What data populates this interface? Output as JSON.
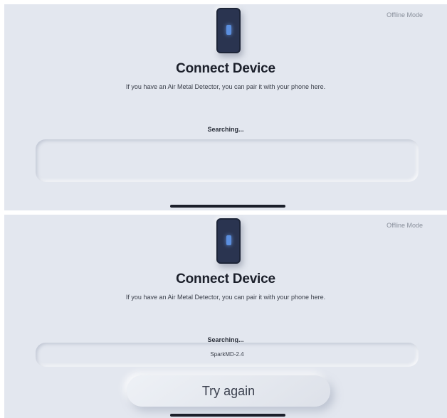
{
  "screens": [
    {
      "offline_mode": "Offline Mode",
      "title": "Connect Device",
      "subtitle": "If you have an Air Metal Detector, you can pair it with your phone here.",
      "status": "Searching...",
      "device_name": ""
    },
    {
      "offline_mode": "Offline Mode",
      "title": "Connect Device",
      "subtitle": "If you have an Air Metal Detector, you can pair it with your phone here.",
      "status": "Searching...",
      "device_name": "SparkMD-2.4",
      "try_again_label": "Try again"
    }
  ]
}
